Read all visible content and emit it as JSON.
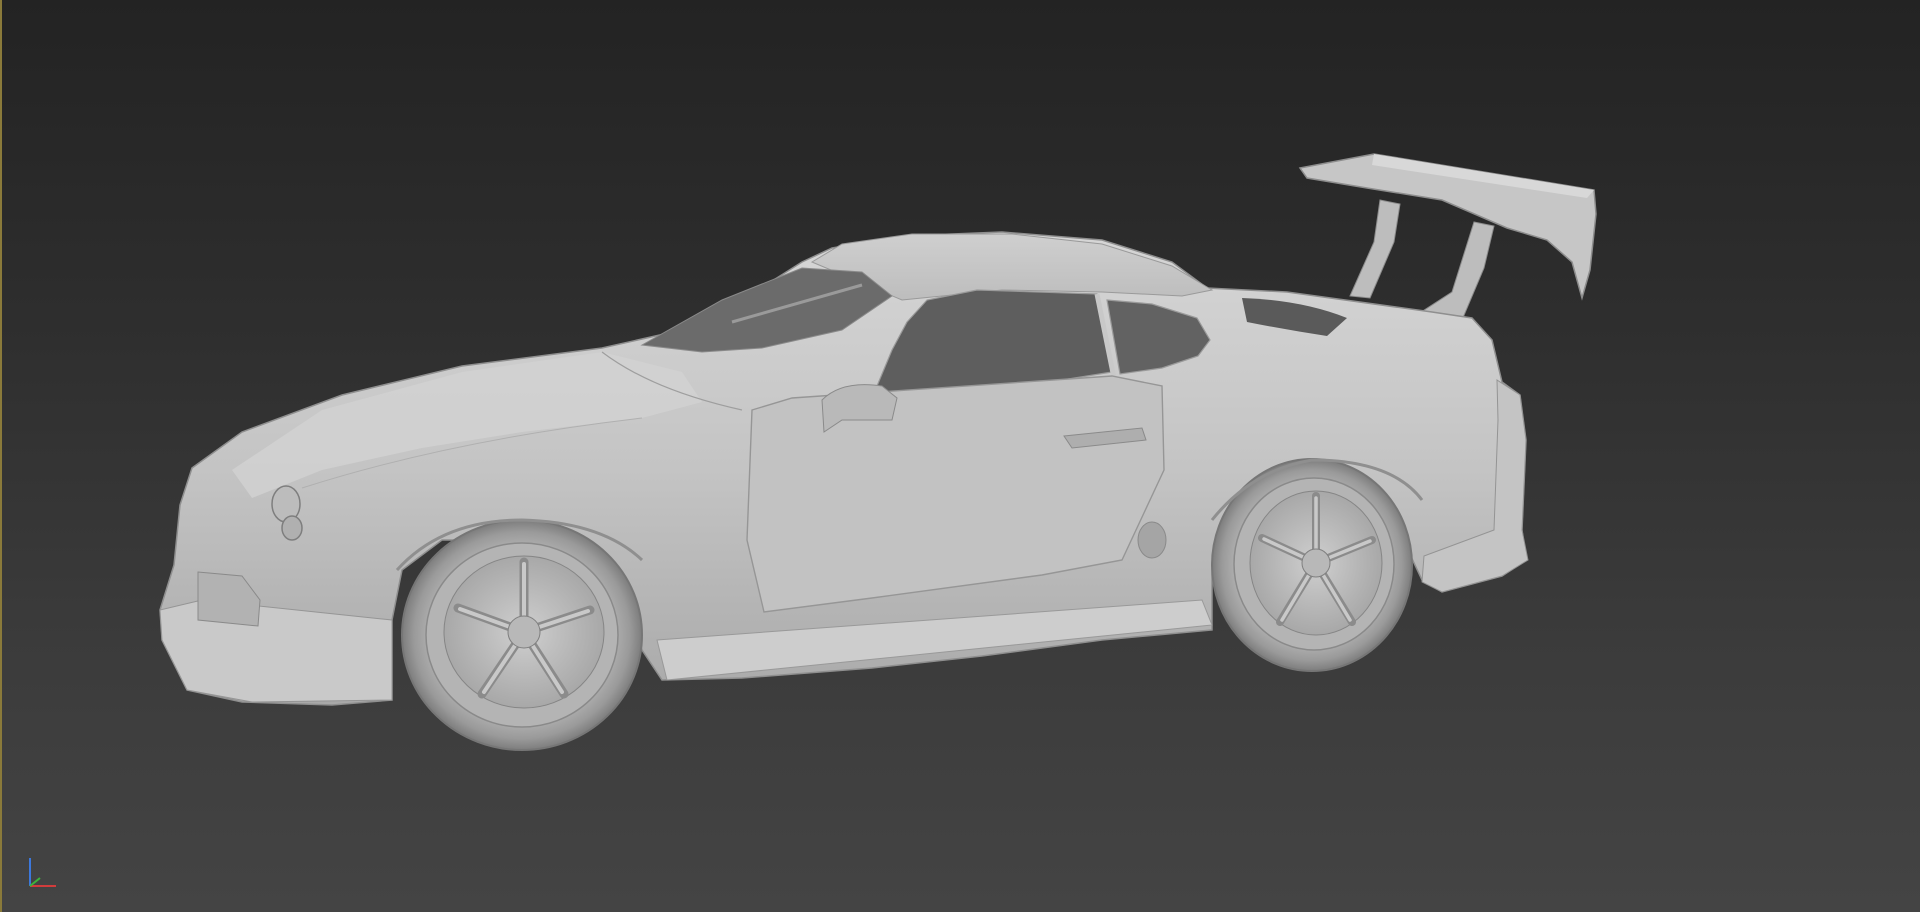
{
  "viewport": {
    "shading": "shaded",
    "background_top": "#232323",
    "background_bottom": "#444444",
    "active_border_color": "#8a7a3a",
    "model_color": "#c8c8c8"
  },
  "gizmo": {
    "icon": "xyz-axis-icon",
    "x_color": "#d23c3c",
    "y_color": "#3cb43c",
    "z_color": "#3c78dc"
  }
}
